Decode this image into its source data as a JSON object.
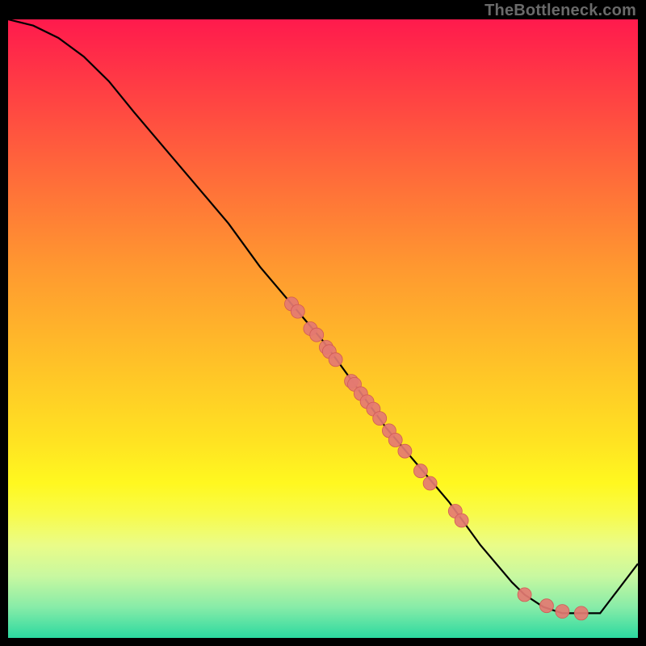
{
  "watermark": "TheBottleneck.com",
  "chart_data": {
    "type": "line",
    "title": "",
    "xlabel": "",
    "ylabel": "",
    "xlim": [
      0,
      100
    ],
    "ylim": [
      0,
      100
    ],
    "series": [
      {
        "name": "curve",
        "x": [
          0,
          4,
          8,
          12,
          16,
          20,
          25,
          30,
          35,
          40,
          45,
          50,
          55,
          60,
          65,
          70,
          75,
          80,
          82,
          85,
          88,
          90,
          92,
          94,
          100
        ],
        "y": [
          100,
          99,
          97,
          94,
          90,
          85,
          79,
          73,
          67,
          60,
          54,
          48,
          41,
          34,
          28,
          22,
          15,
          9,
          7,
          5,
          4,
          4,
          4,
          4,
          12
        ]
      }
    ],
    "markers": [
      {
        "x": 45.0,
        "y": 54.0
      },
      {
        "x": 46.0,
        "y": 52.8
      },
      {
        "x": 48.0,
        "y": 50.0
      },
      {
        "x": 49.0,
        "y": 49.0
      },
      {
        "x": 50.5,
        "y": 47.0
      },
      {
        "x": 51.0,
        "y": 46.3
      },
      {
        "x": 52.0,
        "y": 45.0
      },
      {
        "x": 54.5,
        "y": 41.5
      },
      {
        "x": 55.0,
        "y": 41.0
      },
      {
        "x": 56.0,
        "y": 39.5
      },
      {
        "x": 57.0,
        "y": 38.2
      },
      {
        "x": 58.0,
        "y": 37.0
      },
      {
        "x": 59.0,
        "y": 35.5
      },
      {
        "x": 60.5,
        "y": 33.5
      },
      {
        "x": 61.5,
        "y": 32.0
      },
      {
        "x": 63.0,
        "y": 30.2
      },
      {
        "x": 65.5,
        "y": 27.0
      },
      {
        "x": 67.0,
        "y": 25.0
      },
      {
        "x": 71.0,
        "y": 20.5
      },
      {
        "x": 72.0,
        "y": 19.0
      },
      {
        "x": 82.0,
        "y": 7.0
      },
      {
        "x": 85.5,
        "y": 5.2
      },
      {
        "x": 88.0,
        "y": 4.3
      },
      {
        "x": 91.0,
        "y": 4.0
      }
    ],
    "colors": {
      "curve": "#000000",
      "marker_fill": "#e47a72",
      "marker_stroke": "#d15a55"
    }
  }
}
